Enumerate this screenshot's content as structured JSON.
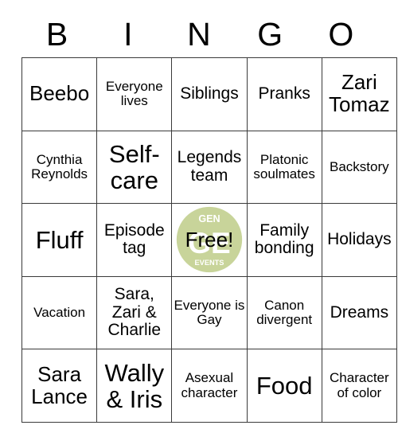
{
  "card": {
    "header_letters": [
      "B",
      "I",
      "N",
      "G",
      "O"
    ],
    "free_space_label": "Free!",
    "watermark": {
      "top_text": "GEN",
      "bottom_text": "EVENTS",
      "monogram": "GE",
      "color": "#c8d49a"
    },
    "rows": [
      [
        {
          "text": "Beebo",
          "size": "fs-lg"
        },
        {
          "text": "Everyone lives",
          "size": "fs-sm"
        },
        {
          "text": "Siblings",
          "size": "fs-md"
        },
        {
          "text": "Pranks",
          "size": "fs-md"
        },
        {
          "text": "Zari Tomaz",
          "size": "fs-lg"
        }
      ],
      [
        {
          "text": "Cynthia Reynolds",
          "size": "fs-sm"
        },
        {
          "text": "Self-care",
          "size": "fs-xl"
        },
        {
          "text": "Legends team",
          "size": "fs-md"
        },
        {
          "text": "Platonic soulmates",
          "size": "fs-sm"
        },
        {
          "text": "Backstory",
          "size": "fs-sm"
        }
      ],
      [
        {
          "text": "Fluff",
          "size": "fs-xl"
        },
        {
          "text": "Episode tag",
          "size": "fs-md"
        },
        {
          "text": "Free!",
          "size": "fs-lg"
        },
        {
          "text": "Family bonding",
          "size": "fs-md"
        },
        {
          "text": "Holidays",
          "size": "fs-md"
        }
      ],
      [
        {
          "text": "Vacation",
          "size": "fs-sm"
        },
        {
          "text": "Sara, Zari & Charlie",
          "size": "fs-md"
        },
        {
          "text": "Everyone is Gay",
          "size": "fs-sm"
        },
        {
          "text": "Canon divergent",
          "size": "fs-sm"
        },
        {
          "text": "Dreams",
          "size": "fs-md"
        }
      ],
      [
        {
          "text": "Sara Lance",
          "size": "fs-lg"
        },
        {
          "text": "Wally & Iris",
          "size": "fs-xl"
        },
        {
          "text": "Asexual character",
          "size": "fs-sm"
        },
        {
          "text": "Food",
          "size": "fs-xl"
        },
        {
          "text": "Character of color",
          "size": "fs-sm"
        }
      ]
    ]
  }
}
